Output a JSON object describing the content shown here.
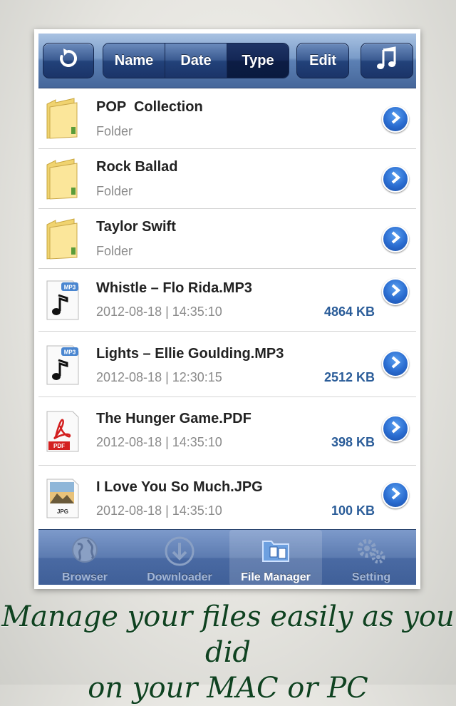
{
  "toolbar": {
    "refresh_icon": "refresh-icon",
    "sort_tabs": [
      {
        "label": "Name",
        "active": false
      },
      {
        "label": "Date",
        "active": false
      },
      {
        "label": "Type",
        "active": true
      }
    ],
    "edit_label": "Edit",
    "music_icon": "music-note-icon"
  },
  "files": [
    {
      "name": "POP  Collection",
      "detail": "Folder",
      "size": "",
      "icon": "folder-icon"
    },
    {
      "name": "Rock Ballad",
      "detail": "Folder",
      "size": "",
      "icon": "folder-icon"
    },
    {
      "name": "Taylor Swift",
      "detail": "Folder",
      "size": "",
      "icon": "folder-icon"
    },
    {
      "name": "Whistle – Flo Rida.MP3",
      "detail": "2012-08-18 | 14:35:10",
      "size": "4864 KB",
      "icon": "mp3-file-icon",
      "badge": "MP3"
    },
    {
      "name": "Lights – Ellie Goulding.MP3",
      "detail": "2012-08-18 | 12:30:15",
      "size": "2512 KB",
      "icon": "mp3-file-icon",
      "badge": "MP3"
    },
    {
      "name": "The Hunger Game.PDF",
      "detail": "2012-08-18 | 14:35:10",
      "size": "398 KB",
      "icon": "pdf-file-icon",
      "badge": "PDF"
    },
    {
      "name": "I Love You So Much.JPG",
      "detail": "2012-08-18 | 14:35:10",
      "size": "100 KB",
      "icon": "jpg-file-icon",
      "badge": "JPG"
    }
  ],
  "tabs": [
    {
      "label": "Browser",
      "icon": "globe-icon",
      "active": false
    },
    {
      "label": "Downloader",
      "icon": "download-icon",
      "active": false
    },
    {
      "label": "File Manager",
      "icon": "file-manager-icon",
      "active": true
    },
    {
      "label": "Setting",
      "icon": "gears-icon",
      "active": false
    }
  ],
  "caption": {
    "line1": "Manage your files easily as you did",
    "line2": "on your MAC or PC"
  },
  "colors": {
    "toolbar": "#46679a",
    "size_text": "#2b5d99",
    "caption": "#0f4220",
    "disclosure": "#2a6cd0"
  }
}
